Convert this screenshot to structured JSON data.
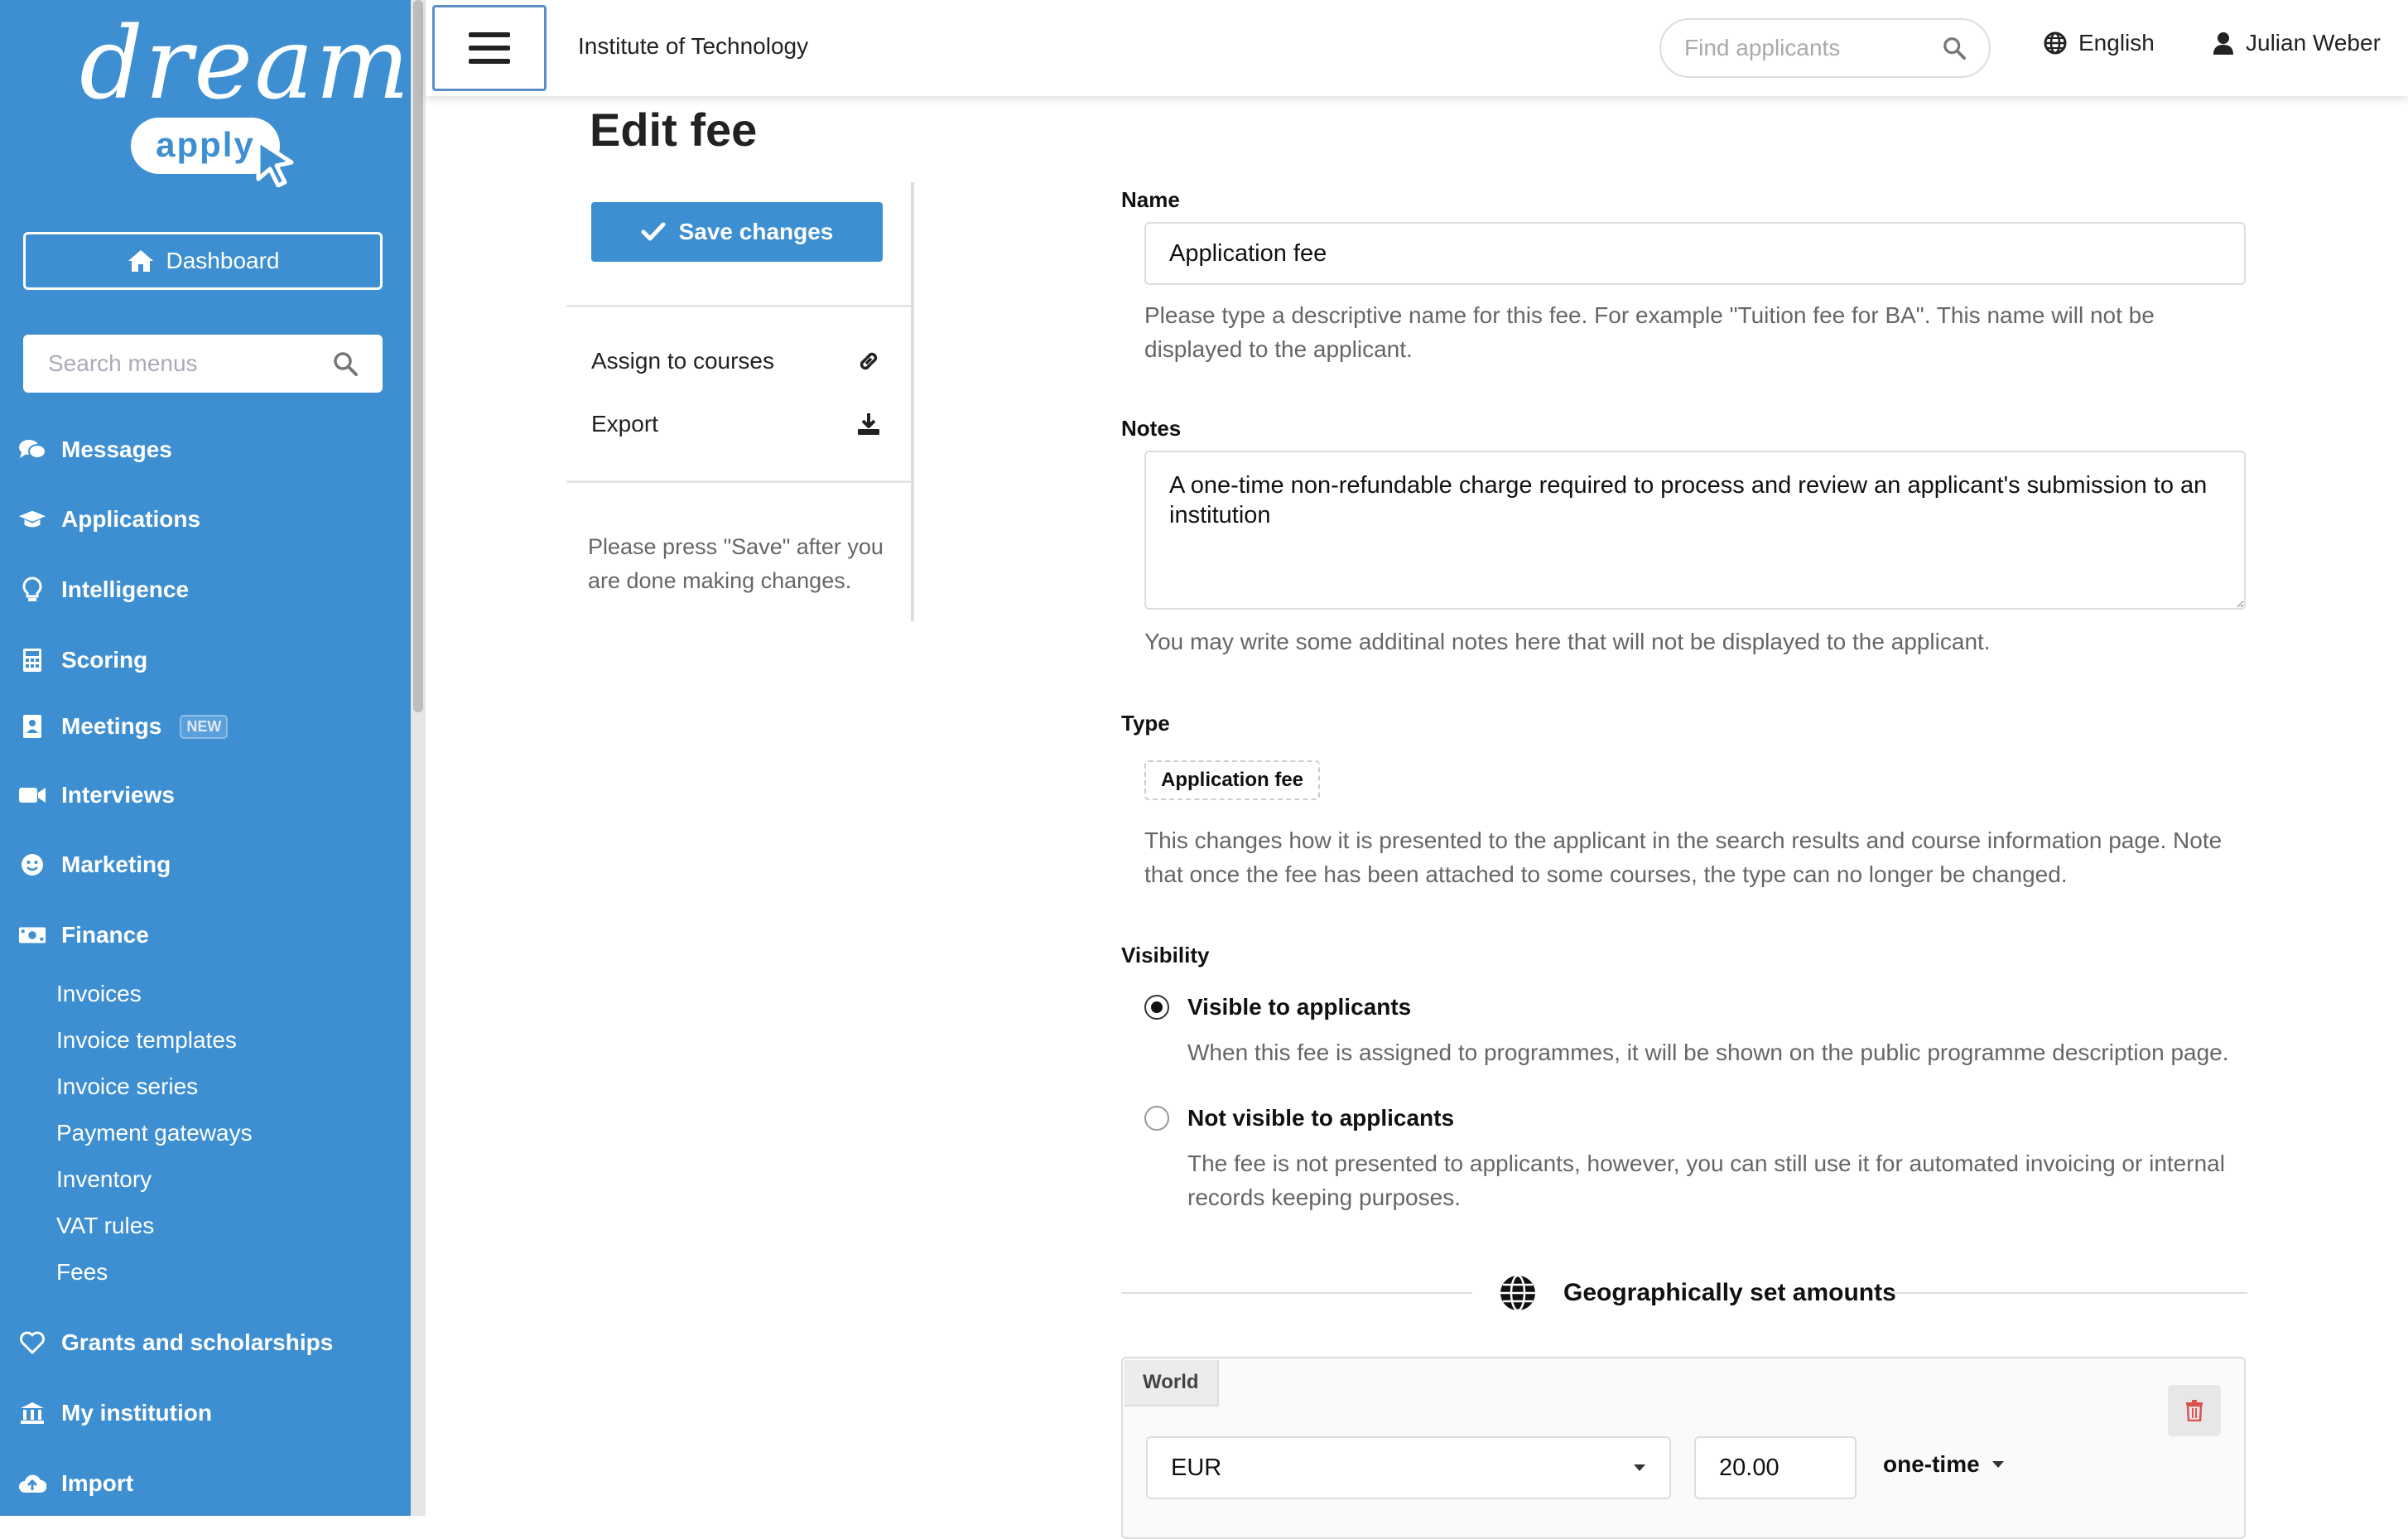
{
  "brand": {
    "wordmark": "dream",
    "badge": "apply"
  },
  "sidebar": {
    "dashboard_label": "Dashboard",
    "search_placeholder": "Search menus",
    "items": [
      {
        "label": "Messages",
        "icon": "comments-icon"
      },
      {
        "label": "Applications",
        "icon": "graduation-cap-icon"
      },
      {
        "label": "Intelligence",
        "icon": "lightbulb-icon"
      },
      {
        "label": "Scoring",
        "icon": "calculator-icon"
      },
      {
        "label": "Meetings",
        "icon": "contact-card-icon",
        "badge": "NEW"
      },
      {
        "label": "Interviews",
        "icon": "video-camera-icon"
      },
      {
        "label": "Marketing",
        "icon": "smiley-icon"
      },
      {
        "label": "Finance",
        "icon": "money-bill-icon"
      },
      {
        "label": "Grants and scholarships",
        "icon": "heart-icon"
      },
      {
        "label": "My institution",
        "icon": "institution-icon"
      },
      {
        "label": "Import",
        "icon": "cloud-upload-icon"
      }
    ],
    "finance_subitems": [
      "Invoices",
      "Invoice templates",
      "Invoice series",
      "Payment gateways",
      "Inventory",
      "VAT rules",
      "Fees"
    ]
  },
  "topbar": {
    "institution": "Institute of Technology",
    "search_placeholder": "Find applicants",
    "language": "English",
    "user": "Julian Weber"
  },
  "page": {
    "title": "Edit fee",
    "save_label": "Save changes",
    "actions": [
      "Assign to courses",
      "Export"
    ],
    "save_note": "Please press \"Save\" after you are done making changes."
  },
  "form": {
    "name_label": "Name",
    "name_value": "Application fee",
    "name_help": "Please type a descriptive name for this fee. For example \"Tuition fee for BA\". This name will not be displayed to the applicant.",
    "notes_label": "Notes",
    "notes_value": "A one-time non-refundable charge required to process and review an applicant's submission to an institution",
    "notes_help": "You may write some additinal notes here that will not be displayed to the applicant.",
    "type_label": "Type",
    "type_value": "Application fee",
    "type_help": "This changes how it is presented to the applicant in the search results and course information page. Note that once the fee has been attached to some courses, the type can no longer be changed.",
    "visibility_label": "Visibility",
    "visibility_options": [
      {
        "label": "Visible to applicants",
        "help": "When this fee is assigned to programmes, it will be shown on the public programme description page.",
        "selected": true
      },
      {
        "label": "Not visible to applicants",
        "help": "The fee is not presented to applicants, however, you can still use it for automated invoicing or internal records keeping purposes.",
        "selected": false
      }
    ],
    "geo_heading": "Geographically set amounts",
    "region": {
      "name": "World",
      "currency": "EUR",
      "amount": "20.00",
      "frequency": "one-time"
    }
  },
  "colors": {
    "sidebar": "#3d8fd1",
    "accent": "#3d8fd1",
    "danger": "#d9534f"
  }
}
